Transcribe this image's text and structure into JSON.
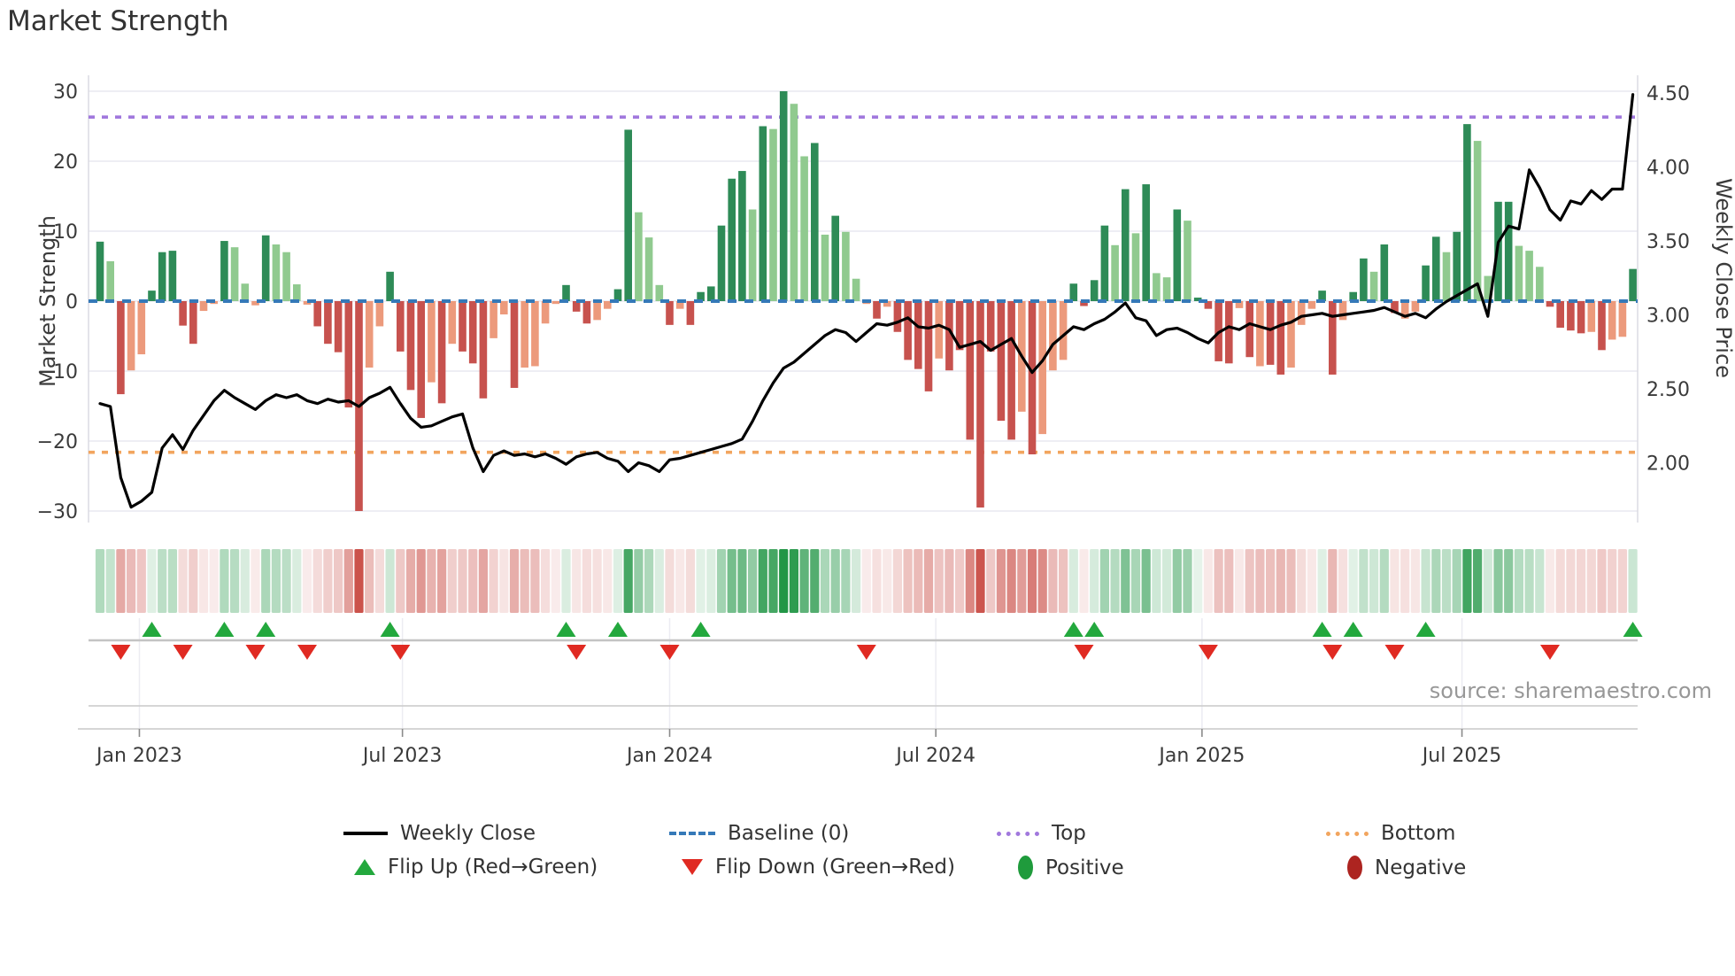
{
  "title": "Market Strength",
  "source": "source: sharemaestro.com",
  "colors": {
    "dark_green": "#2e8b57",
    "light_green": "#90ca8f",
    "dark_red": "#c7524e",
    "salmon": "#ec9a7c",
    "baseline_blue": "#3579b8",
    "top_purple": "#a178dd",
    "bottom_orange": "#f2a55e",
    "price_line": "#000000",
    "grid": "#e9e9f0",
    "spine": "#d9d9e0",
    "axis_text": "#3a3a3a",
    "lane_line": "#c4c4c4",
    "flip_up_green": "#23a83d",
    "flip_down_red": "#e02a22",
    "heat_green": "34,150,70",
    "heat_red": "203,82,75"
  },
  "left_axis": {
    "label": "Market Strength",
    "ticks": [
      {
        "label": "30",
        "value": 30
      },
      {
        "label": "20",
        "value": 20
      },
      {
        "label": "10",
        "value": 10
      },
      {
        "label": "0",
        "value": 0
      },
      {
        "label": "−10",
        "value": -10
      },
      {
        "label": "−20",
        "value": -20
      },
      {
        "label": "−30",
        "value": -30
      }
    ]
  },
  "right_axis": {
    "label": "Weekly Close Price",
    "ticks": [
      {
        "label": "4.50",
        "value": 4.5
      },
      {
        "label": "4.00",
        "value": 4.0
      },
      {
        "label": "3.50",
        "value": 3.5
      },
      {
        "label": "3.00",
        "value": 3.0
      },
      {
        "label": "2.50",
        "value": 2.5
      },
      {
        "label": "2.00",
        "value": 2.0
      }
    ]
  },
  "x_axis": {
    "ticks": [
      {
        "label": "Jan 2023",
        "week": 3.8
      },
      {
        "label": "Jul 2023",
        "week": 29.2
      },
      {
        "label": "Jan 2024",
        "week": 55.0
      },
      {
        "label": "Jul 2024",
        "week": 80.7
      },
      {
        "label": "Jan 2025",
        "week": 106.4
      },
      {
        "label": "Jul 2025",
        "week": 131.5
      }
    ]
  },
  "reference_lines": {
    "top": 26.3,
    "baseline": 0,
    "bottom": -21.6
  },
  "legend": {
    "row1": [
      {
        "label": "Weekly Close",
        "swatch": "line"
      },
      {
        "label": "Baseline (0)",
        "swatch": "dash-blue"
      },
      {
        "label": "Top",
        "swatch": "dot-purple"
      },
      {
        "label": "Bottom",
        "swatch": "dot-orange"
      }
    ],
    "row2": [
      {
        "label": "Flip Up (Red→Green)",
        "swatch": "triangle-up"
      },
      {
        "label": "Flip Down (Green→Red)",
        "swatch": "triangle-down"
      },
      {
        "label": "Positive",
        "swatch": "circle-green"
      },
      {
        "label": "Negative",
        "swatch": "circle-red"
      }
    ]
  },
  "chart_data": {
    "type": "bar",
    "title": "Market Strength",
    "ylabel": "Market Strength",
    "y2label": "Weekly Close Price",
    "ylim": [
      -32,
      32
    ],
    "y2lim_ticks": [
      2.0,
      4.5
    ],
    "weeks": 149,
    "strength": [
      8.5,
      5.7,
      -13.3,
      -9.9,
      -7.6,
      1.5,
      7.0,
      7.2,
      -3.5,
      -6.1,
      -1.4,
      -0.4,
      8.6,
      7.7,
      2.5,
      -0.6,
      9.4,
      8.1,
      7.0,
      2.4,
      -0.5,
      -3.6,
      -6.1,
      -7.3,
      -15.2,
      -30.0,
      -9.5,
      -3.6,
      4.2,
      -7.2,
      -12.7,
      -16.7,
      -11.6,
      -14.6,
      -6.1,
      -7.2,
      -8.9,
      -13.9,
      -5.3,
      -1.9,
      -12.4,
      -9.5,
      -9.3,
      -3.2,
      -0.4,
      2.3,
      -1.5,
      -3.2,
      -2.7,
      -1.1,
      1.7,
      24.5,
      12.7,
      9.1,
      2.3,
      -3.4,
      -1.1,
      -3.4,
      1.3,
      2.1,
      10.8,
      17.5,
      18.6,
      13.1,
      25.0,
      24.6,
      30.0,
      28.2,
      20.7,
      22.6,
      9.5,
      12.2,
      9.9,
      3.2,
      -0.4,
      -2.5,
      -0.8,
      -4.4,
      -8.4,
      -9.7,
      -12.9,
      -8.2,
      -9.9,
      -7.0,
      -19.8,
      -29.5,
      -7.2,
      -17.1,
      -19.8,
      -15.8,
      -21.9,
      -19.0,
      -9.9,
      -8.4,
      2.5,
      -0.7,
      3.0,
      10.8,
      8.0,
      16.0,
      9.7,
      16.7,
      4.0,
      3.4,
      13.1,
      11.5,
      0.5,
      -1.1,
      -8.6,
      -8.9,
      -1.0,
      -8.0,
      -9.3,
      -9.1,
      -10.5,
      -9.5,
      -3.4,
      -1.1,
      1.5,
      -10.5,
      -2.7,
      1.3,
      6.1,
      4.2,
      8.1,
      -1.7,
      -2.5,
      -1.5,
      5.1,
      9.2,
      7.0,
      9.9,
      25.3,
      22.9,
      3.6,
      14.2,
      14.2,
      7.9,
      7.2,
      4.9,
      -0.8,
      -3.8,
      -4.2,
      -4.6,
      -4.4,
      -7.0,
      -5.5,
      -5.1,
      4.6
    ],
    "bar_class": [
      "dg",
      "lg",
      "dr",
      "sa",
      "sa",
      "dg",
      "dg",
      "dg",
      "dr",
      "dr",
      "sa",
      "sa",
      "dg",
      "lg",
      "lg",
      "sa",
      "dg",
      "lg",
      "lg",
      "lg",
      "sa",
      "dr",
      "dr",
      "dr",
      "dr",
      "dr",
      "sa",
      "sa",
      "dg",
      "dr",
      "dr",
      "dr",
      "sa",
      "dr",
      "sa",
      "dr",
      "dr",
      "dr",
      "sa",
      "sa",
      "dr",
      "sa",
      "sa",
      "sa",
      "sa",
      "dg",
      "dr",
      "dr",
      "sa",
      "sa",
      "dg",
      "dg",
      "lg",
      "lg",
      "lg",
      "dr",
      "sa",
      "dr",
      "dg",
      "dg",
      "dg",
      "dg",
      "dg",
      "lg",
      "dg",
      "lg",
      "dg",
      "lg",
      "lg",
      "dg",
      "lg",
      "dg",
      "lg",
      "lg",
      "sa",
      "dr",
      "sa",
      "dr",
      "dr",
      "dr",
      "dr",
      "sa",
      "dr",
      "dr",
      "dr",
      "dr",
      "dr",
      "dr",
      "dr",
      "sa",
      "dr",
      "sa",
      "sa",
      "sa",
      "dg",
      "dr",
      "dg",
      "dg",
      "lg",
      "dg",
      "lg",
      "dg",
      "lg",
      "lg",
      "dg",
      "lg",
      "dg",
      "dr",
      "dr",
      "dr",
      "sa",
      "dr",
      "sa",
      "dr",
      "dr",
      "sa",
      "sa",
      "sa",
      "dg",
      "dr",
      "sa",
      "dg",
      "dg",
      "lg",
      "dg",
      "dr",
      "sa",
      "sa",
      "dg",
      "dg",
      "lg",
      "dg",
      "dg",
      "lg",
      "lg",
      "dg",
      "dg",
      "lg",
      "lg",
      "lg",
      "dr",
      "dr",
      "dr",
      "dr",
      "sa",
      "dr",
      "sa",
      "sa",
      "dg"
    ],
    "price": [
      2.4,
      2.38,
      1.9,
      1.7,
      1.74,
      1.8,
      2.1,
      2.19,
      2.09,
      2.22,
      2.32,
      2.42,
      2.49,
      2.44,
      2.4,
      2.36,
      2.42,
      2.46,
      2.44,
      2.46,
      2.42,
      2.4,
      2.43,
      2.41,
      2.42,
      2.38,
      2.44,
      2.47,
      2.51,
      2.4,
      2.3,
      2.24,
      2.25,
      2.28,
      2.31,
      2.33,
      2.1,
      1.94,
      2.05,
      2.08,
      2.05,
      2.06,
      2.04,
      2.06,
      2.03,
      1.99,
      2.04,
      2.06,
      2.07,
      2.03,
      2.01,
      1.94,
      2.0,
      1.98,
      1.94,
      2.02,
      2.03,
      2.05,
      2.07,
      2.09,
      2.11,
      2.13,
      2.16,
      2.28,
      2.42,
      2.54,
      2.64,
      2.68,
      2.74,
      2.8,
      2.86,
      2.9,
      2.88,
      2.82,
      2.88,
      2.94,
      2.93,
      2.95,
      2.98,
      2.92,
      2.91,
      2.93,
      2.9,
      2.78,
      2.8,
      2.82,
      2.76,
      2.8,
      2.84,
      2.72,
      2.61,
      2.69,
      2.8,
      2.86,
      2.92,
      2.9,
      2.94,
      2.97,
      3.02,
      3.08,
      2.98,
      2.96,
      2.86,
      2.9,
      2.91,
      2.88,
      2.84,
      2.81,
      2.88,
      2.92,
      2.9,
      2.94,
      2.92,
      2.9,
      2.93,
      2.95,
      2.99,
      3.0,
      3.01,
      2.99,
      3.0,
      3.01,
      3.02,
      3.03,
      3.05,
      3.02,
      2.99,
      3.01,
      2.98,
      3.04,
      3.09,
      3.13,
      3.17,
      3.21,
      2.99,
      3.49,
      3.6,
      3.58,
      3.98,
      3.86,
      3.71,
      3.64,
      3.77,
      3.75,
      3.84,
      3.78,
      3.85,
      3.85,
      4.49
    ],
    "flip_up_weeks": [
      5,
      12,
      16,
      28,
      45,
      50,
      58,
      94,
      96,
      118,
      121,
      128,
      148
    ],
    "flip_down_weeks": [
      2,
      8,
      15,
      20,
      29,
      46,
      55,
      74,
      95,
      107,
      119,
      125,
      140
    ]
  }
}
